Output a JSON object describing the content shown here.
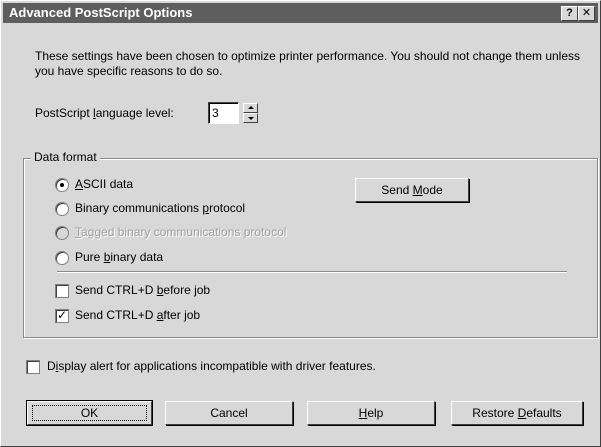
{
  "window": {
    "title": "Advanced PostScript Options",
    "help_glyph": "?",
    "close_glyph": "✕"
  },
  "description": "These settings have been chosen to optimize printer performance. You should not change them unless you have specific reasons to do so.",
  "language_level": {
    "label_pre": "PostScript ",
    "label_mnemonic": "l",
    "label_post": "anguage level:",
    "value": "3"
  },
  "data_format": {
    "title": "Data format",
    "options": [
      {
        "pre": "",
        "mn": "A",
        "post": "SCII data",
        "selected": true,
        "disabled": false
      },
      {
        "pre": "Binary communications ",
        "mn": "p",
        "post": "rotocol",
        "selected": false,
        "disabled": false
      },
      {
        "pre": "",
        "mn": "T",
        "post": "agged binary communications protocol",
        "selected": false,
        "disabled": true
      },
      {
        "pre": "Pure ",
        "mn": "b",
        "post": "inary data",
        "selected": false,
        "disabled": false
      }
    ],
    "send_mode": {
      "pre": "Send ",
      "mn": "M",
      "post": "ode"
    },
    "ctrl_d_before": {
      "pre": "Send CTRL+D ",
      "mn": "b",
      "post": "efore job",
      "checked": false
    },
    "ctrl_d_after": {
      "pre": "Send CTRL+D ",
      "mn": "a",
      "post": "fter job",
      "checked": true
    }
  },
  "display_alert": {
    "pre": "D",
    "mn": "i",
    "post": "splay alert for applications incompatible with driver features.",
    "checked": false
  },
  "buttons": {
    "ok": "OK",
    "cancel": "Cancel",
    "help_mn": "H",
    "help_post": "elp",
    "restore_pre": "Restore ",
    "restore_mn": "D",
    "restore_post": "efaults"
  },
  "colors": {
    "titlebar": "#5e5e5e",
    "face": "#d8d8d8",
    "disabled_text": "#a0a0a0"
  }
}
